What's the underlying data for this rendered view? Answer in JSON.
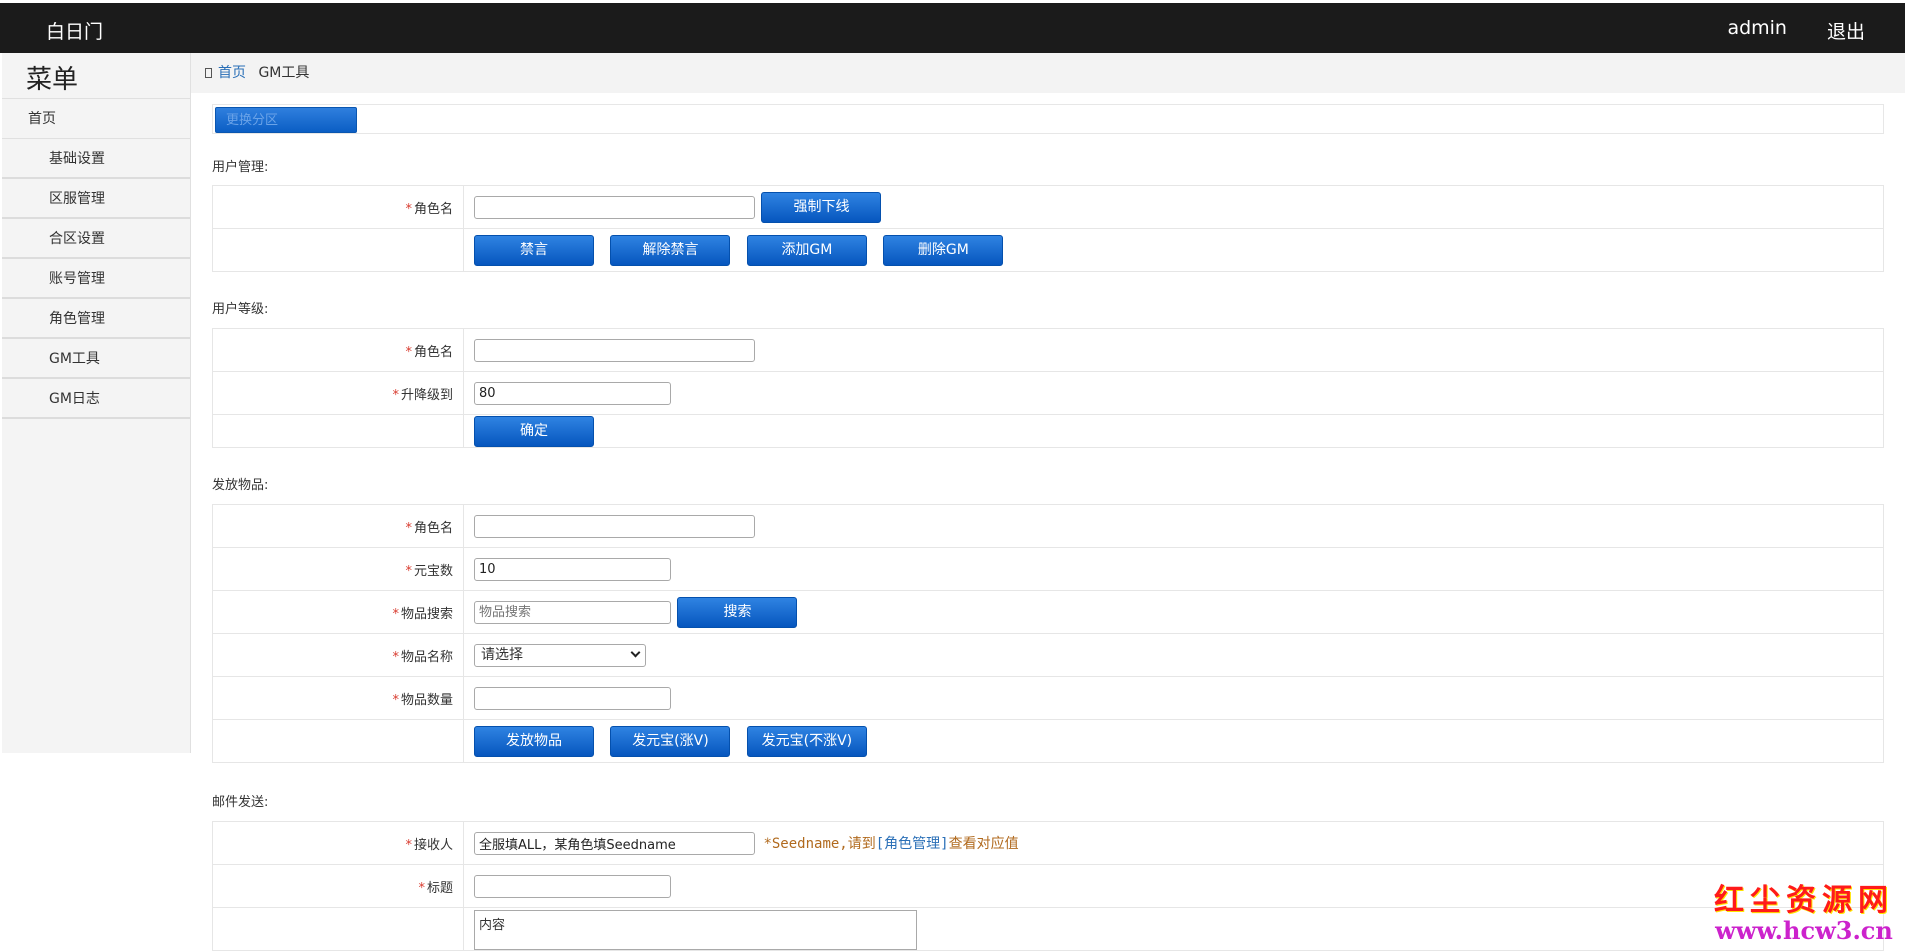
{
  "header": {
    "brand": "白日门",
    "user": "admin",
    "logout": "退出"
  },
  "sidebar": {
    "title": "菜单",
    "home": "首页",
    "items": [
      "基础设置",
      "区服管理",
      "合区设置",
      "账号管理",
      "角色管理",
      "GM工具",
      "GM日志"
    ]
  },
  "breadcrumb": {
    "home": "首页",
    "current": "GM工具"
  },
  "zone": {
    "button": "更换分区"
  },
  "user_mgmt": {
    "title": "用户管理:",
    "role_label": "角色名",
    "role_value": "",
    "kick_button": "强制下线",
    "buttons": [
      "禁言",
      "解除禁言",
      "添加GM",
      "删除GM"
    ]
  },
  "user_level": {
    "title": "用户等级:",
    "role_label": "角色名",
    "role_value": "",
    "level_label": "升降级到",
    "level_value": "80",
    "confirm_button": "确定"
  },
  "items_grant": {
    "title": "发放物品:",
    "role_label": "角色名",
    "role_value": "",
    "yuanbao_label": "元宝数",
    "yuanbao_value": "10",
    "search_label": "物品搜索",
    "search_placeholder": "物品搜索",
    "search_button": "搜索",
    "name_label": "物品名称",
    "name_selected": "请选择",
    "qty_label": "物品数量",
    "qty_value": "",
    "buttons": [
      "发放物品",
      "发元宝(涨V)",
      "发元宝(不涨V)"
    ]
  },
  "mail": {
    "title": "邮件发送:",
    "recipient_label": "接收人",
    "recipient_value": "全服填ALL，某角色填Seedname",
    "hint_pre": "*Seedname,请到",
    "hint_link": "[角色管理]",
    "hint_post": "查看对应值",
    "subject_label": "标题",
    "subject_value": "",
    "content_value": "内容"
  },
  "watermark": {
    "line1": "红尘资源网",
    "line2": "www.hcw3.cn"
  },
  "colors": {
    "topbar": "#1b1b1b",
    "button": "#0b5ec4",
    "required": "#d83a2e",
    "hint": "#b16a1e",
    "link": "#2a6fb7"
  }
}
